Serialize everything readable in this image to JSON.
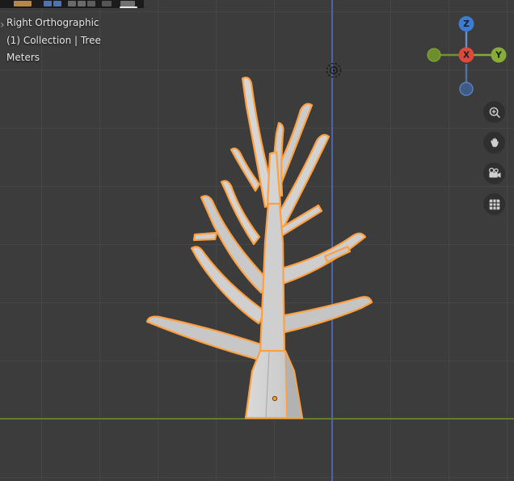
{
  "colors": {
    "viewport_bg": "#3c3c3c",
    "grid_line": "#464646",
    "axis_green": "#5d7f2f",
    "axis_blue": "#4a66a8",
    "selection": "#ffa040",
    "object_light": "#d3d3d3",
    "object_dark": "#b6b6b6",
    "text": "#e6e6e6",
    "header_bg": "#1b1b1b",
    "gizmo_x": "#dd4a3c",
    "gizmo_y": "#87ad37",
    "gizmo_y_neg": "#6e8d2d",
    "gizmo_z": "#3d7cd0",
    "gizmo_z_neg": "#3d5b85"
  },
  "viewport": {
    "view_name": "Right Orthographic",
    "breadcrumb": "(1) Collection | Tree",
    "units": "Meters"
  },
  "gizmo": {
    "z_label": "Z",
    "x_label": "X",
    "y_label": "Y"
  },
  "icons": {
    "toolbar_toggle": "›",
    "right_toolbar": [
      "magnifier-plus-icon",
      "hand-icon",
      "camera-icon",
      "grid-icon"
    ],
    "scene_markers": [
      "point-light-icon",
      "object-origin-dot"
    ]
  },
  "scene": {
    "selected_object": "Tree"
  }
}
